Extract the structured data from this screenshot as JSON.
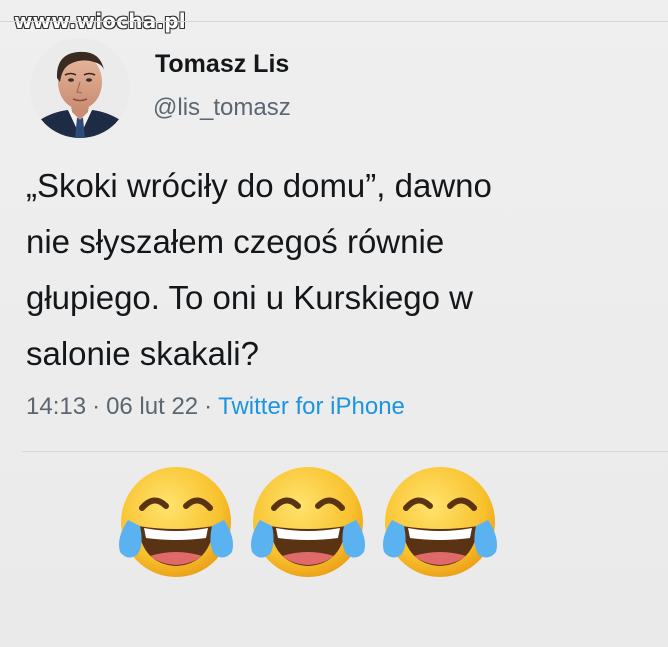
{
  "watermark": "www.wiocha.pl",
  "author": {
    "display_name": "Tomasz Lis",
    "handle": "@lis_tomasz"
  },
  "tweet": {
    "lines": [
      "„Skoki wróciły do domu”, dawno",
      "nie słyszałem czegoś równie",
      "głupiego. To oni u Kurskiego w",
      "salonie skakali?"
    ],
    "time": "14:13",
    "date": "06 lut 22",
    "separator": "·",
    "source": "Twitter for iPhone"
  },
  "emojis": [
    "face-with-tears-of-joy",
    "face-with-tears-of-joy",
    "face-with-tears-of-joy"
  ],
  "colors": {
    "text": "#14171a",
    "secondary": "#5b6670",
    "link": "#1b95e0",
    "emoji_face": "#f8c12c"
  }
}
